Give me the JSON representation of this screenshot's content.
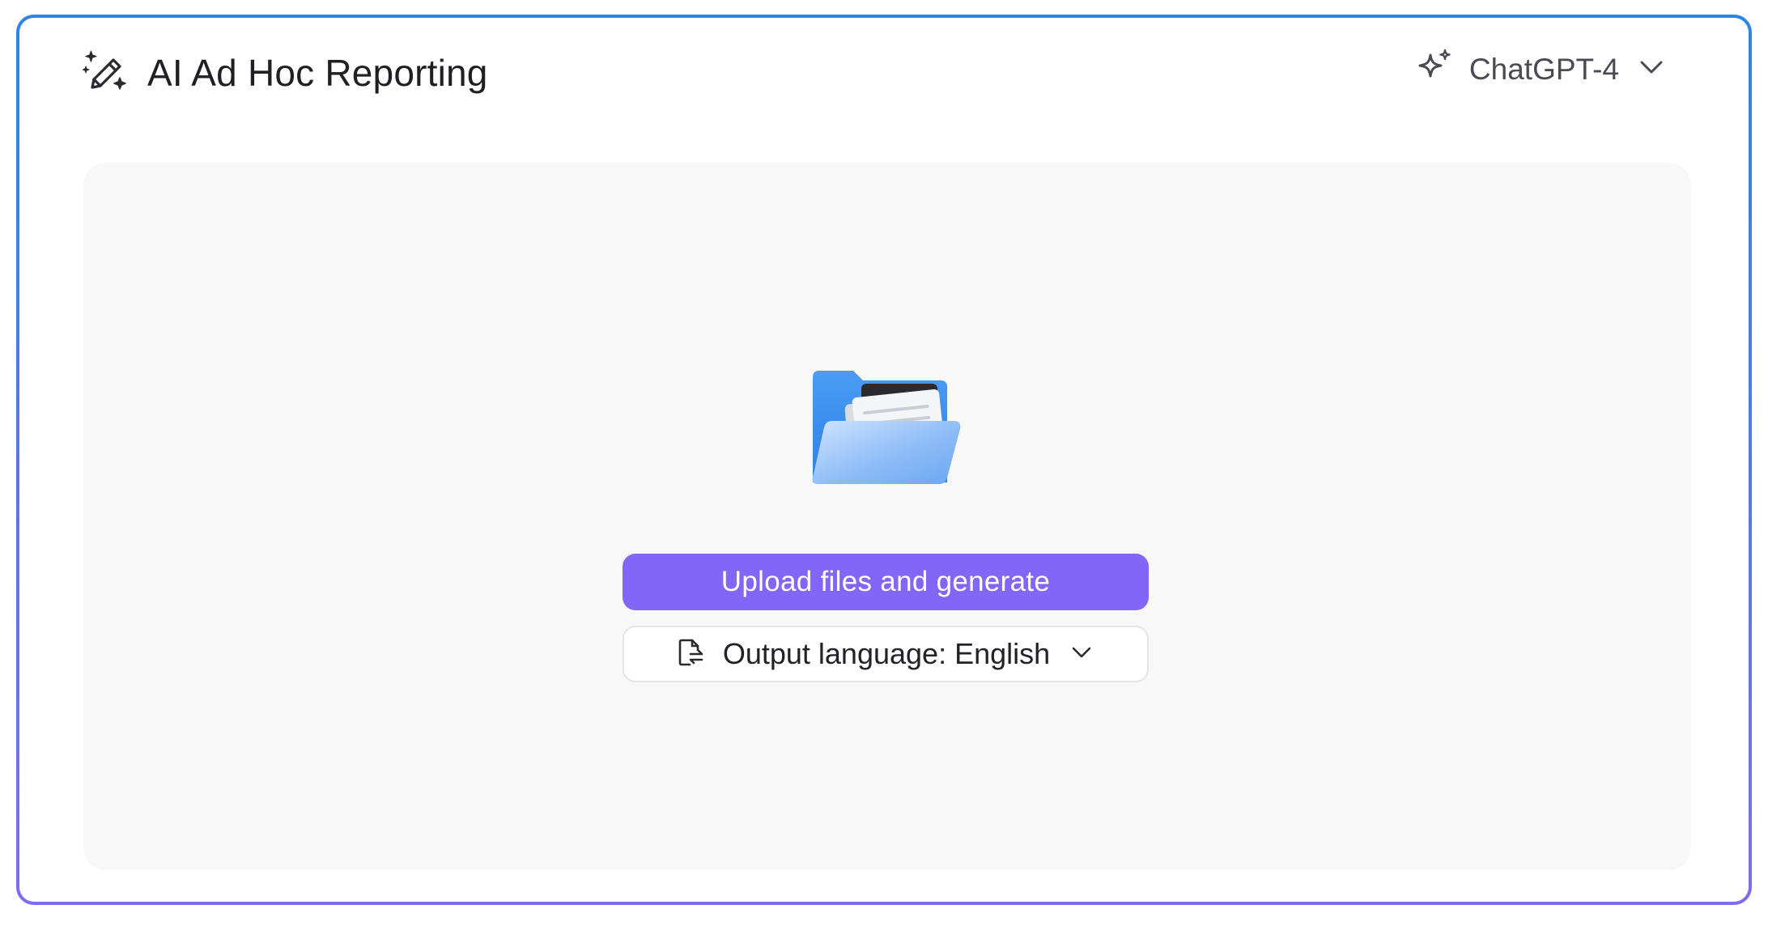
{
  "header": {
    "title": "AI Ad Hoc Reporting",
    "icon": "magic-pen-icon"
  },
  "model_selector": {
    "icon": "sparkle-icon",
    "selected": "ChatGPT-4",
    "chevron": "chevron-down-icon"
  },
  "dropzone": {
    "illustration": "folder-documents-icon",
    "upload_label": "Upload files and generate",
    "language": {
      "icon": "document-translate-icon",
      "label": "Output language: English",
      "chevron": "chevron-down-icon"
    }
  },
  "colors": {
    "accent": "#8266f6",
    "border_top": "#2a86e4",
    "border_bottom": "#7d6cf0",
    "panel_bg": "#f8f8f8"
  }
}
